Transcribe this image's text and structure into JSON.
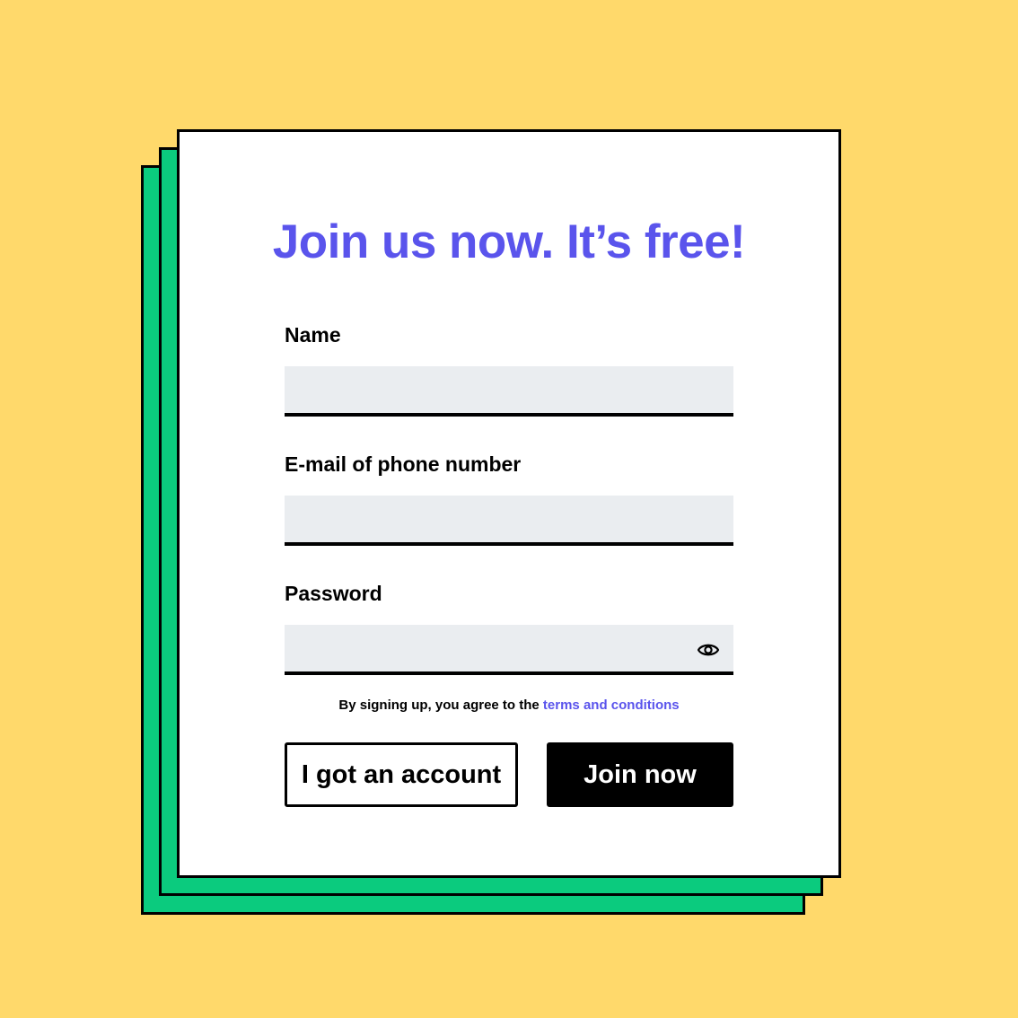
{
  "colors": {
    "background": "#FFD96B",
    "stack_sheets": "#0BCB7E",
    "card": "#FFFFFF",
    "accent": "#5A54EC",
    "input_fill": "#EAEDF0",
    "primary_button": "#000000"
  },
  "form": {
    "title": "Join us now. It’s free!",
    "fields": [
      {
        "label": "Name",
        "value": "",
        "placeholder": ""
      },
      {
        "label": "E-mail of phone number",
        "value": "",
        "placeholder": ""
      },
      {
        "label": "Password",
        "value": "",
        "placeholder": "",
        "icon": "eye-icon"
      }
    ],
    "terms": {
      "prefix": "By signing up, you agree to the ",
      "link": "terms and conditions"
    },
    "buttons": {
      "secondary": "I got an account",
      "primary": "Join now"
    }
  }
}
